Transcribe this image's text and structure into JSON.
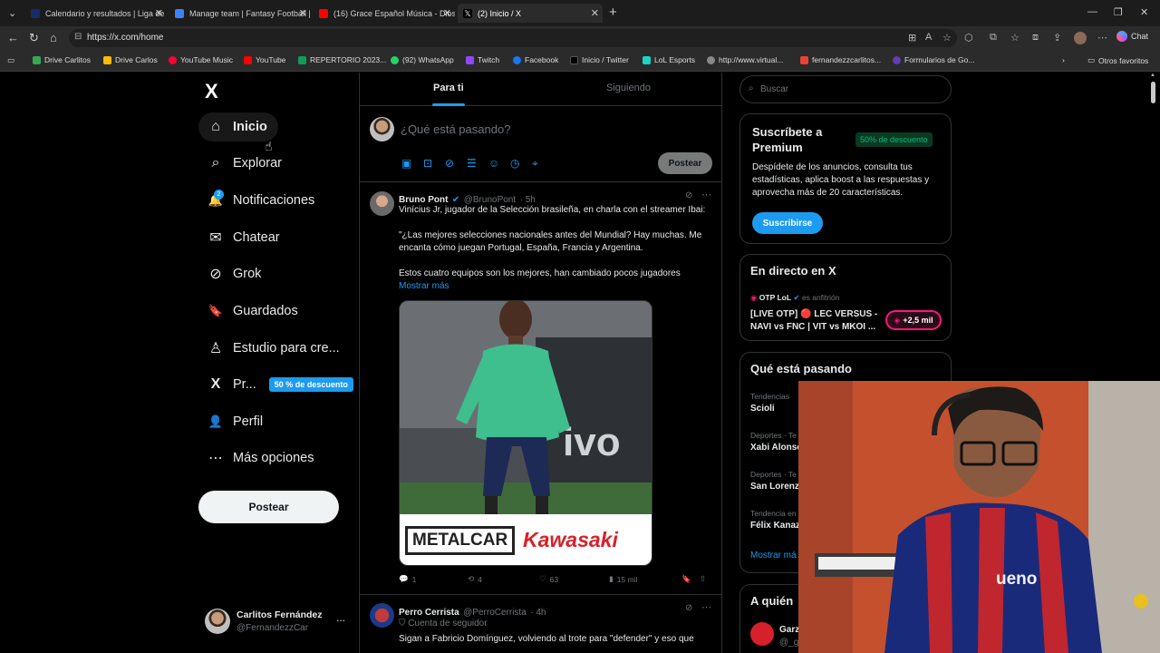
{
  "browser": {
    "tabs": [
      {
        "title": "Calendario y resultados | Liga de C",
        "color": "#1a2b6b"
      },
      {
        "title": "Manage team | Fantasy Football | ",
        "color": "#3b82f6"
      },
      {
        "title": "(16) Grace Español Música - Dios d",
        "color": "#ff0000"
      },
      {
        "title": "(2) Inicio / X",
        "color": "#000000"
      }
    ],
    "url": "https://x.com/home",
    "chat_label": "Chat",
    "bookmarks": [
      {
        "label": "Drive Carlitos",
        "color": "#34a853"
      },
      {
        "label": "Drive Carlos",
        "color": "#fbbc04"
      },
      {
        "label": "YouTube Music",
        "color": "#ff0033"
      },
      {
        "label": "YouTube",
        "color": "#ff0000"
      },
      {
        "label": "REPERTORIO 2023...",
        "color": "#0f9d58"
      },
      {
        "label": "(92) WhatsApp",
        "color": "#25d366"
      },
      {
        "label": "Twitch",
        "color": "#9146ff"
      },
      {
        "label": "Facebook",
        "color": "#1877f2"
      },
      {
        "label": "Inicio / Twitter",
        "color": "#000000"
      },
      {
        "label": "LoL Esports",
        "color": "#1ad4c4"
      },
      {
        "label": "http://www.virtual...",
        "color": "#888888"
      },
      {
        "label": "fernandezzcarlitos...",
        "color": "#ea4335"
      },
      {
        "label": "Formularios de Go...",
        "color": "#673ab7"
      }
    ],
    "other_bookmarks": "Otros favoritos"
  },
  "sidebar": {
    "logo": "X",
    "items": [
      {
        "label": "Inicio",
        "icon": "home-icon",
        "glyph": "⌂"
      },
      {
        "label": "Explorar",
        "icon": "search-icon",
        "glyph": "⌕"
      },
      {
        "label": "Notificaciones",
        "icon": "bell-icon",
        "glyph": "🔔"
      },
      {
        "label": "Chatear",
        "icon": "mail-icon",
        "glyph": "✉"
      },
      {
        "label": "Grok",
        "icon": "grok-icon",
        "glyph": "⊘"
      },
      {
        "label": "Guardados",
        "icon": "bookmark-icon",
        "glyph": "🔖"
      },
      {
        "label": "Estudio para cre...",
        "icon": "creator-studio-icon",
        "glyph": "♙"
      },
      {
        "label": "Pr...",
        "icon": "x-premium-icon",
        "glyph": "X"
      },
      {
        "label": "Perfil",
        "icon": "profile-icon",
        "glyph": "👤"
      },
      {
        "label": "Más opciones",
        "icon": "more-options-icon",
        "glyph": "⋯"
      }
    ],
    "notification_count": "2",
    "premium_discount": "50 % de descuento",
    "post_button": "Postear",
    "user": {
      "name": "Carlitos Fernández",
      "handle": "@FernandezzCar",
      "menu": "..."
    }
  },
  "feed": {
    "tabs": [
      "Para ti",
      "Siguiendo"
    ],
    "compose_placeholder": "¿Qué está pasando?",
    "compose_post": "Postear",
    "tweets": [
      {
        "name": "Bruno Pont",
        "handle": "@BrunoPont",
        "time": "· 5h",
        "text1": "Vinícius Jr, jugador de la Selección brasileña, en charla con el streamer Ibai:",
        "text2": "\"¿Las mejores selecciones nacionales antes del Mundial? Hay muchas. Me encanta cómo juegan Portugal, España, Francia y Argentina.",
        "text3": "Estos cuatro equipos son los mejores, han cambiado pocos jugadores",
        "more": "Mostrar más",
        "sponsor1": "METALCAR",
        "sponsor2": "Kawasaki",
        "replies": "1",
        "retweets": "4",
        "likes": "63",
        "views": "15 mil"
      },
      {
        "name": "Perro Cerrista",
        "handle": "@PerroCerrista",
        "time": "· 4h",
        "subtitle": "Cuenta de seguidor",
        "text1": "Sigan a Fabricio Domínguez, volviendo al trote para \"defender\" y eso que"
      }
    ]
  },
  "right": {
    "search_placeholder": "Buscar",
    "premium": {
      "title1": "Suscríbete a",
      "title2": "Premium",
      "discount": "50% de descuento",
      "text": "Despídete de los anuncios, consulta tus estadísticas, aplica boost a las respuestas y aprovecha más de 20 características.",
      "button": "Suscribirse"
    },
    "live": {
      "title": "En directo en X",
      "host": "OTP LoL",
      "host_suffix": "es anfitrión",
      "text1": "[LIVE OTP] 🔴 LEC VERSUS -",
      "text2": "NAVI vs FNC | VIT vs MKOI ...",
      "count": "+2,5 mil"
    },
    "trends": {
      "title": "Qué está pasando",
      "items": [
        {
          "category": "Tendencias",
          "name": "Scioli"
        },
        {
          "category": "Deportes · Te",
          "name": "Xabi Alonso"
        },
        {
          "category": "Deportes · Te",
          "name": "San Lorenzo"
        },
        {
          "category": "Tendencia en",
          "name": "Félix Kanaz"
        }
      ],
      "show_more": "Mostrar má"
    },
    "who_to_follow": {
      "title": "A quién",
      "name": "Garz",
      "handle": "@_g"
    }
  },
  "webcam": {
    "shirt_text": "ueno"
  }
}
